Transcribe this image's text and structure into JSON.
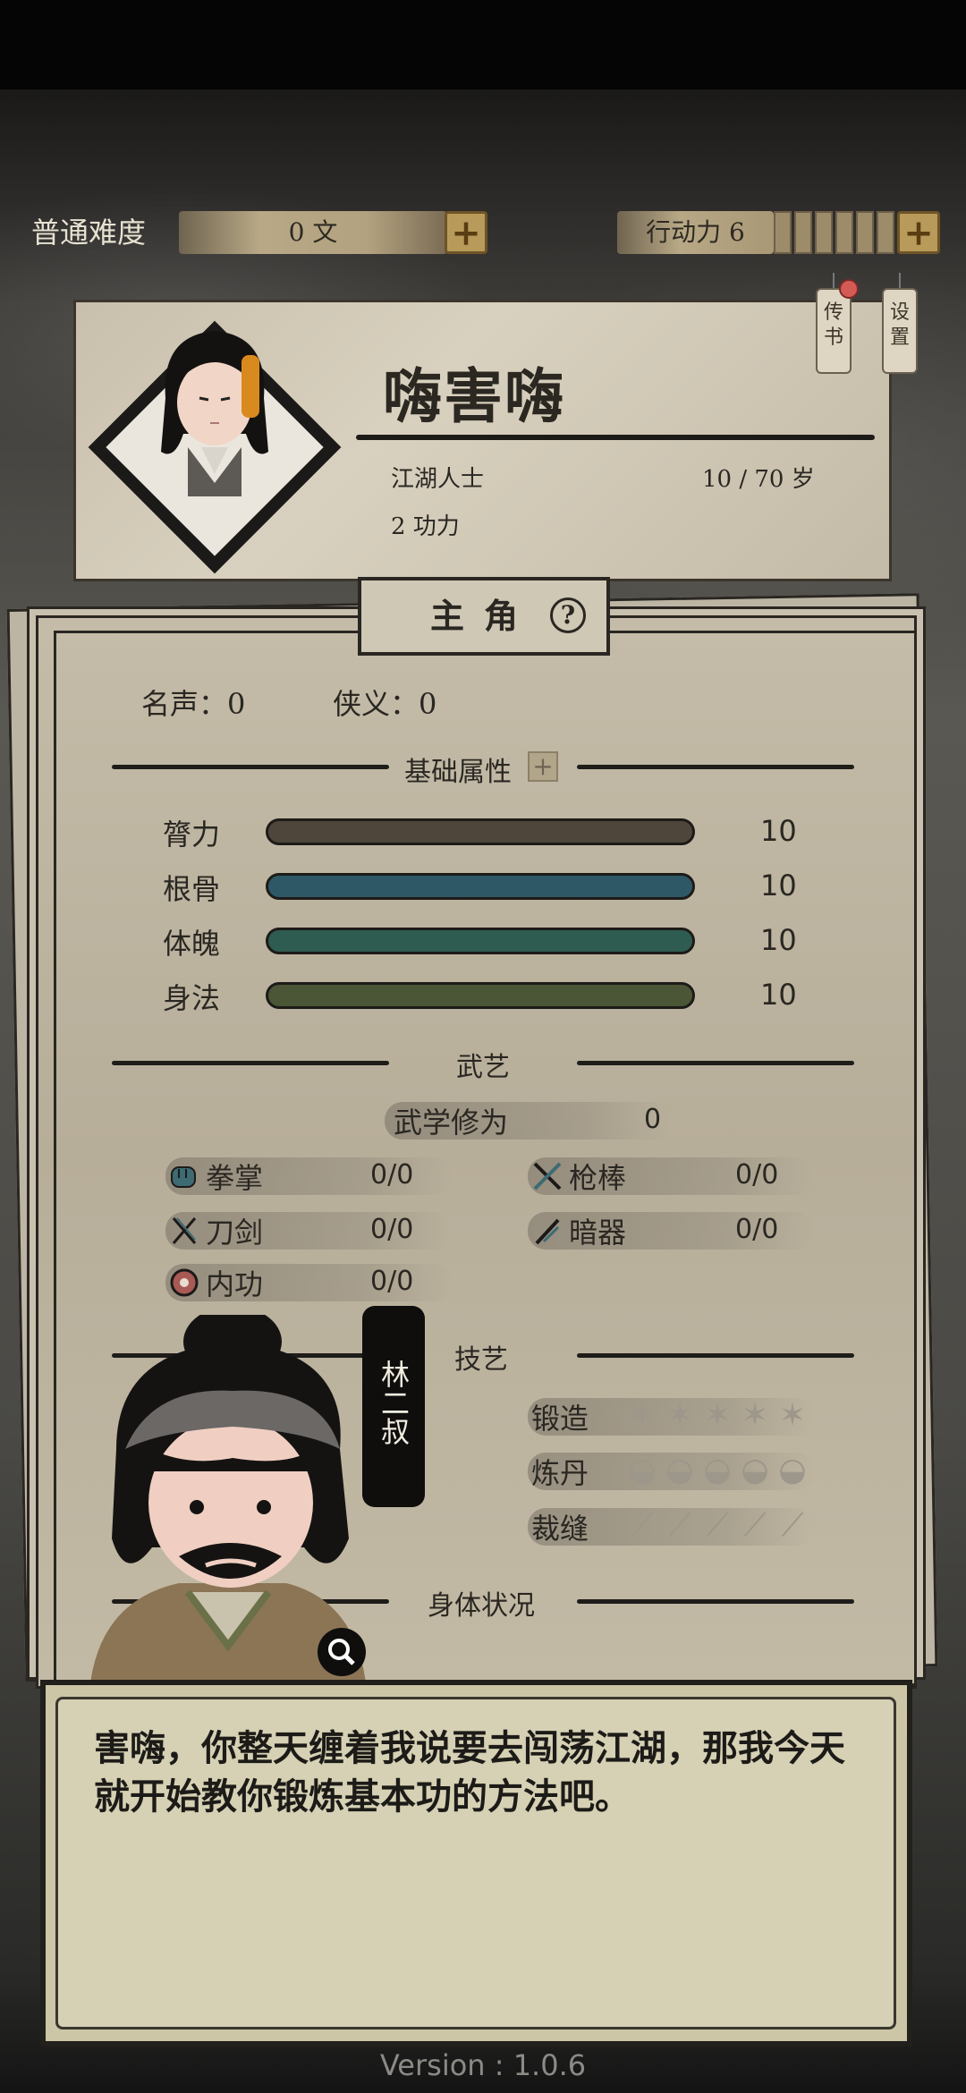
{
  "hud": {
    "difficulty": "普通难度",
    "money": "0 文",
    "action_label": "行动力 6",
    "action_slots": 6
  },
  "tabs": {
    "letters": "传书",
    "settings": "设置"
  },
  "profile": {
    "name": "嗨害嗨",
    "title": "江湖人士",
    "age": "10 / 70 岁",
    "power": "2 功力"
  },
  "panel": {
    "tab_label": "主角",
    "help": "?",
    "fame": "名声：0",
    "chivalry": "侠义：0",
    "basic_attrs_title": "基础属性",
    "attributes": [
      {
        "name": "膂力",
        "value": "10",
        "color": "#4e463b"
      },
      {
        "name": "根骨",
        "value": "10",
        "color": "#2f5866"
      },
      {
        "name": "体魄",
        "value": "10",
        "color": "#2f5c50"
      },
      {
        "name": "身法",
        "value": "10",
        "color": "#4b5636"
      }
    ],
    "martial_title": "武艺",
    "martial_cultivation_label": "武学修为",
    "martial_cultivation_value": "0",
    "martial_skills": [
      {
        "name": "拳掌",
        "value": "0/0",
        "icon": "fist-icon"
      },
      {
        "name": "枪棒",
        "value": "0/0",
        "icon": "spear-icon"
      },
      {
        "name": "刀剑",
        "value": "0/0",
        "icon": "swords-icon"
      },
      {
        "name": "暗器",
        "value": "0/0",
        "icon": "dart-icon"
      },
      {
        "name": "内功",
        "value": "0/0",
        "icon": "inner-power-icon"
      }
    ],
    "crafts_title": "技艺",
    "crafts": [
      {
        "name": "锻造",
        "stars": 5
      },
      {
        "name": "炼丹",
        "stars": 5
      },
      {
        "name": "裁缝",
        "stars": 5
      }
    ],
    "body_status_title": "身体状况"
  },
  "npc": {
    "name": "林二叔"
  },
  "dialog": {
    "text": "害嗨，你整天缠着我说要去闯荡江湖，那我今天就开始教你锻炼基本功的方法吧。"
  },
  "version": "Version : 1.0.6"
}
